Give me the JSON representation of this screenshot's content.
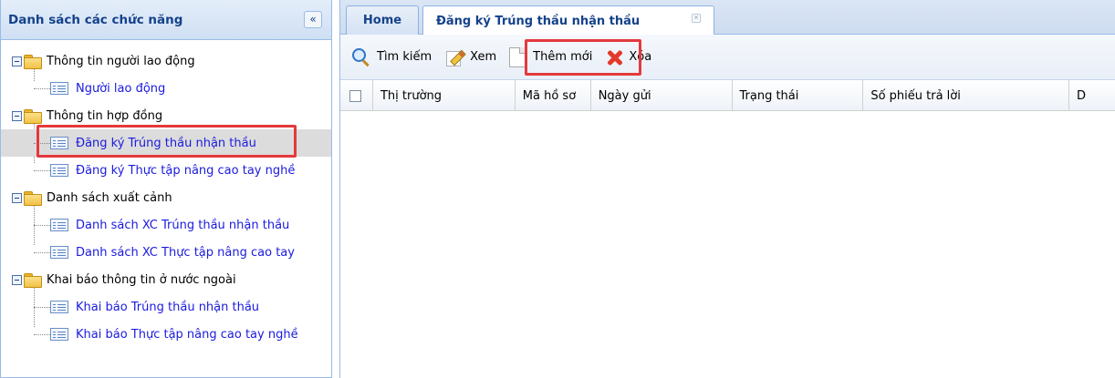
{
  "sidebar": {
    "title": "Danh sách các chức năng",
    "collapse_label": "«",
    "groups": [
      {
        "label": "Thông tin người lao động",
        "items": [
          {
            "label": "Người lao động"
          }
        ]
      },
      {
        "label": "Thông tin hợp đồng",
        "items": [
          {
            "label": "Đăng ký Trúng thầu nhận thầu",
            "selected": true
          },
          {
            "label": "Đăng ký Thực tập nâng cao tay nghề"
          }
        ]
      },
      {
        "label": "Danh sách xuất cảnh",
        "items": [
          {
            "label": "Danh sách XC Trúng thầu nhận thầu"
          },
          {
            "label": "Danh sách XC Thực tập nâng cao tay"
          }
        ]
      },
      {
        "label": "Khai báo thông tin ở nước ngoài",
        "items": [
          {
            "label": "Khai báo Trúng thầu nhận thầu"
          },
          {
            "label": "Khai báo Thực tập nâng cao tay nghề"
          }
        ]
      }
    ]
  },
  "tabs": {
    "home": "Home",
    "active": "Đăng ký Trúng thầu nhận thầu",
    "close": "✕"
  },
  "toolbar": {
    "search": "Tìm kiếm",
    "view": "Xem",
    "add": "Thêm mới",
    "delete": "Xóa"
  },
  "grid": {
    "columns": [
      "Thị trường",
      "Mã hồ sơ",
      "Ngày gửi",
      "Trạng thái",
      "Số phiếu trả lời",
      "D"
    ]
  },
  "colors": {
    "highlight": "#e4393c",
    "link": "#1a1adf",
    "header_text": "#15428b"
  }
}
